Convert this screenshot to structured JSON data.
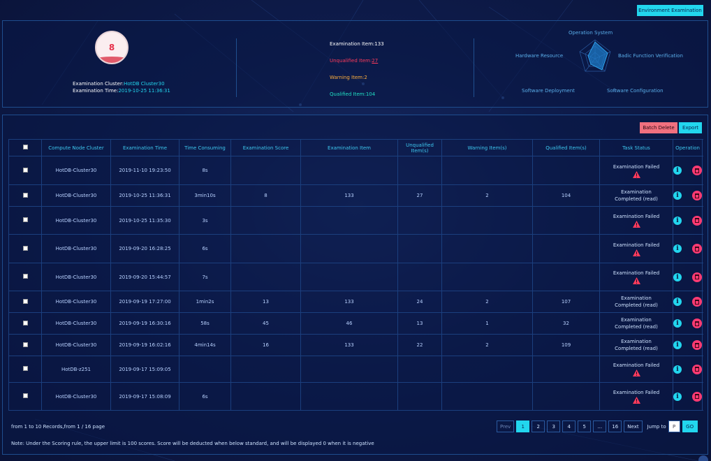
{
  "header": {
    "env_button": "Environment Examination"
  },
  "summary": {
    "score": "8",
    "cluster_label": "Examination Cluster:",
    "cluster_value": "HotDB Cluster30",
    "time_label": "Examination Time:",
    "time_value": "2019-10-25 11:36:31",
    "examination_item_label": "Examination Item:",
    "examination_item_value": "133",
    "unqualified_label": "Unqualified Item:",
    "unqualified_value": "27",
    "warning_label": "Warning Item:",
    "warning_value": "2",
    "qualified_label": "Qualified Item:",
    "qualified_value": "104",
    "colors": {
      "unqualified": "#ff3b5c",
      "warning": "#ffae3d",
      "qualified": "#21e0c4",
      "accent": "#22d6ee"
    }
  },
  "radar": {
    "labels": [
      "Operation System",
      "Badic Function Verification",
      "Software Configuration",
      "Software Deployment",
      "Hardware Resource"
    ]
  },
  "toolbar": {
    "batch_delete": "Batch Delete",
    "export": "Export"
  },
  "table": {
    "headers": [
      "Compute Node Cluster",
      "Examination Time",
      "Time Consuming",
      "Examination Score",
      "Examination Item",
      "Unqualified Item(s)",
      "Warning Item(s)",
      "Qualified Item(s)",
      "Task Status",
      "Operation"
    ],
    "rows": [
      {
        "cluster": "HotDB-Cluster30",
        "time": "2019-11-10 19:23:50",
        "consuming": "8s",
        "score": "",
        "item": "",
        "unqualified": "",
        "warning": "",
        "qualified": "",
        "status1": "Examination Failed",
        "status2": "",
        "failed": true
      },
      {
        "cluster": "HotDB-Cluster30",
        "time": "2019-10-25 11:36:31",
        "consuming": "3min10s",
        "score": "8",
        "item": "133",
        "unqualified": "27",
        "warning": "2",
        "qualified": "104",
        "status1": "Examination",
        "status2": "Completed (read)",
        "failed": false
      },
      {
        "cluster": "HotDB-Cluster30",
        "time": "2019-10-25 11:35:30",
        "consuming": "3s",
        "score": "",
        "item": "",
        "unqualified": "",
        "warning": "",
        "qualified": "",
        "status1": "Examination Failed",
        "status2": "",
        "failed": true
      },
      {
        "cluster": "HotDB-Cluster30",
        "time": "2019-09-20 16:28:25",
        "consuming": "6s",
        "score": "",
        "item": "",
        "unqualified": "",
        "warning": "",
        "qualified": "",
        "status1": "Examination Failed",
        "status2": "",
        "failed": true
      },
      {
        "cluster": "HotDB-Cluster30",
        "time": "2019-09-20 15:44:57",
        "consuming": "7s",
        "score": "",
        "item": "",
        "unqualified": "",
        "warning": "",
        "qualified": "",
        "status1": "Examination Failed",
        "status2": "",
        "failed": true
      },
      {
        "cluster": "HotDB-Cluster30",
        "time": "2019-09-19 17:27:00",
        "consuming": "1min2s",
        "score": "13",
        "item": "133",
        "unqualified": "24",
        "warning": "2",
        "qualified": "107",
        "status1": "Examination",
        "status2": "Completed (read)",
        "failed": false
      },
      {
        "cluster": "HotDB-Cluster30",
        "time": "2019-09-19 16:30:16",
        "consuming": "58s",
        "score": "45",
        "item": "46",
        "unqualified": "13",
        "warning": "1",
        "qualified": "32",
        "status1": "Examination",
        "status2": "Completed (read)",
        "failed": false
      },
      {
        "cluster": "HotDB-Cluster30",
        "time": "2019-09-19 16:02:16",
        "consuming": "4min14s",
        "score": "16",
        "item": "133",
        "unqualified": "22",
        "warning": "2",
        "qualified": "109",
        "status1": "Examination",
        "status2": "Completed (read)",
        "failed": false
      },
      {
        "cluster": "HotDB-z251",
        "time": "2019-09-17 15:09:05",
        "consuming": "",
        "score": "",
        "item": "",
        "unqualified": "",
        "warning": "",
        "qualified": "",
        "status1": "Examination Failed",
        "status2": "",
        "failed": true
      },
      {
        "cluster": "HotDB-Cluster30",
        "time": "2019-09-17 15:08:09",
        "consuming": "6s",
        "score": "",
        "item": "",
        "unqualified": "",
        "warning": "",
        "qualified": "",
        "status1": "Examination Failed",
        "status2": "",
        "failed": true
      }
    ]
  },
  "footer": {
    "records": "from 1 to 10 Records,from 1 / 16 page",
    "note": "Note: Under the Scoring rule, the upper limit is 100 scores. Score will be deducted when below standard, and will be displayed 0 when it is negative"
  },
  "pagination": {
    "prev": "Prev",
    "pages": [
      "1",
      "2",
      "3",
      "4",
      "5",
      "...",
      "16"
    ],
    "active": "1",
    "next": "Next",
    "jump_label": "Jump to",
    "jump_placeholder": "P",
    "go": "GO"
  }
}
